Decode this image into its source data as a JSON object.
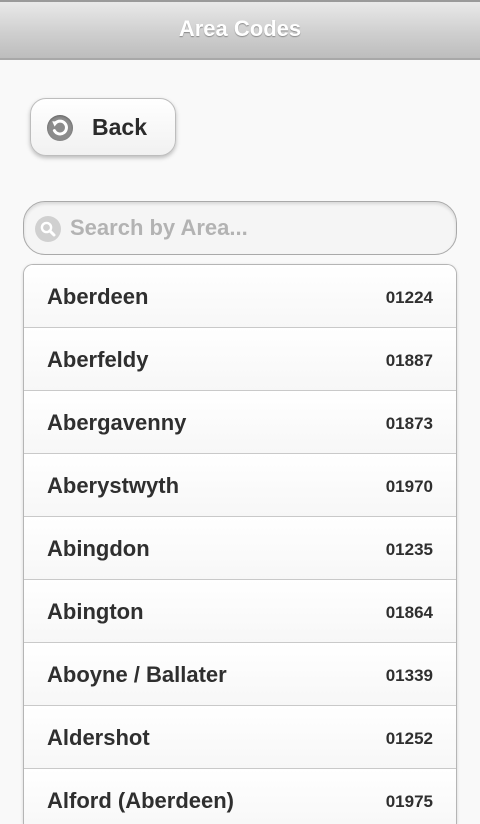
{
  "header": {
    "title": "Area Codes"
  },
  "back_button": {
    "label": "Back"
  },
  "search": {
    "placeholder": "Search by Area...",
    "value": ""
  },
  "areas": [
    {
      "name": "Aberdeen",
      "code": "01224"
    },
    {
      "name": "Aberfeldy",
      "code": "01887"
    },
    {
      "name": "Abergavenny",
      "code": "01873"
    },
    {
      "name": "Aberystwyth",
      "code": "01970"
    },
    {
      "name": "Abingdon",
      "code": "01235"
    },
    {
      "name": "Abington",
      "code": "01864"
    },
    {
      "name": "Aboyne / Ballater",
      "code": "01339"
    },
    {
      "name": "Aldershot",
      "code": "01252"
    },
    {
      "name": "Alford (Aberdeen)",
      "code": "01975"
    }
  ],
  "icons": {
    "back": "back-arrow-icon",
    "search": "search-icon"
  },
  "colors": {
    "header_text": "#ffffff",
    "row_text": "#2f2f2f",
    "placeholder": "#b3b3b3"
  }
}
